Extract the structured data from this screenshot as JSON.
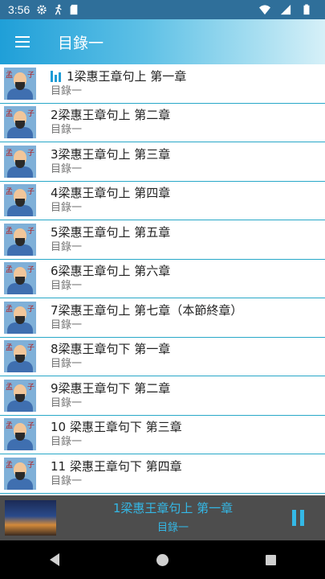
{
  "status_bar": {
    "time": "3:56",
    "left_icons": [
      "gear-icon",
      "run-icon",
      "sd-card-icon"
    ],
    "right_icons": [
      "wifi-icon",
      "signal-icon",
      "battery-icon"
    ]
  },
  "app_bar": {
    "title": "目錄一",
    "menu_icon": "hamburger-menu-icon",
    "gradient_colors": [
      "#1f9fd8",
      "#a9dff1"
    ]
  },
  "list": {
    "items": [
      {
        "title": "1梁惠王章句上 第一章",
        "subtitle": "目錄一",
        "playing": true
      },
      {
        "title": "2梁惠王章句上 第二章",
        "subtitle": "目錄一",
        "playing": false
      },
      {
        "title": "3梁惠王章句上 第三章",
        "subtitle": "目錄一",
        "playing": false
      },
      {
        "title": "4梁惠王章句上 第四章",
        "subtitle": "目錄一",
        "playing": false
      },
      {
        "title": "5梁惠王章句上 第五章",
        "subtitle": "目錄一",
        "playing": false
      },
      {
        "title": "6梁惠王章句上 第六章",
        "subtitle": "目錄一",
        "playing": false
      },
      {
        "title": "7梁惠王章句上 第七章（本節終章）",
        "subtitle": "目錄一",
        "playing": false
      },
      {
        "title": "8梁惠王章句下 第一章",
        "subtitle": "目錄一",
        "playing": false
      },
      {
        "title": "9梁惠王章句下 第二章",
        "subtitle": "目錄一",
        "playing": false
      },
      {
        "title": "10 梁惠王章句下 第三章",
        "subtitle": "目錄一",
        "playing": false
      },
      {
        "title": "11 梁惠王章句下 第四章",
        "subtitle": "目錄一",
        "playing": false
      }
    ],
    "thumb_chars": [
      "孟",
      "子"
    ]
  },
  "player": {
    "title": "1梁惠王章句上 第一章",
    "subtitle": "目錄一",
    "button_icon": "pause-icon",
    "accent_color": "#34b8e6"
  },
  "nav_bar": {
    "icons": [
      "back-icon",
      "home-icon",
      "recents-icon"
    ]
  }
}
